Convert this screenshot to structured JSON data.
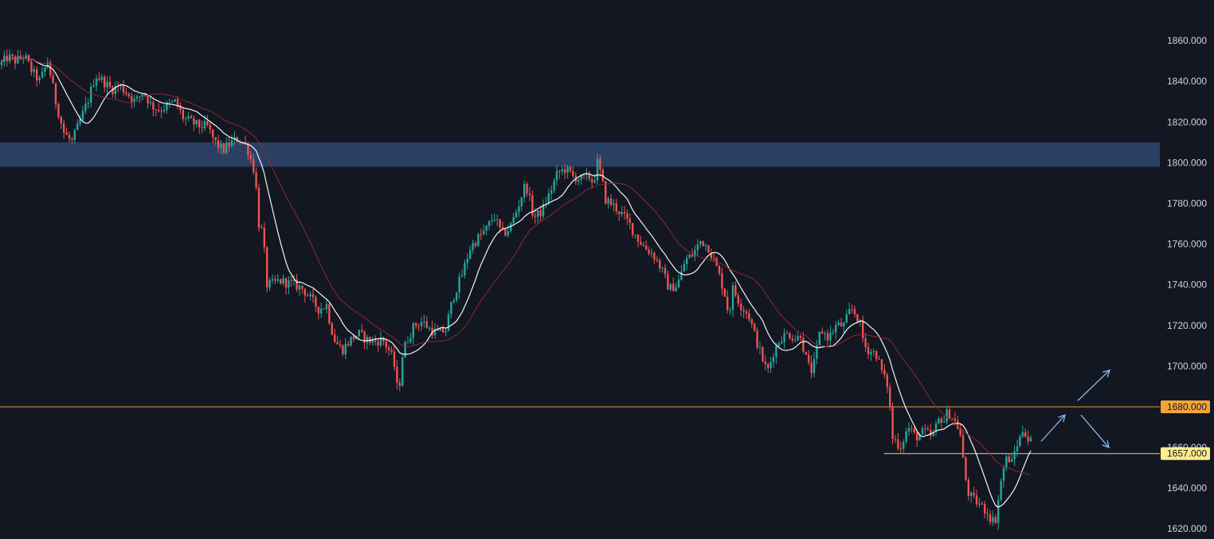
{
  "chart_data": {
    "type": "candlestick",
    "ylim": [
      1615,
      1880
    ],
    "y_ticks": [
      {
        "value": 1620,
        "label": "1620.000"
      },
      {
        "value": 1640,
        "label": "1640.000"
      },
      {
        "value": 1660,
        "label": "1660.000"
      },
      {
        "value": 1680,
        "label": "1680.000"
      },
      {
        "value": 1700,
        "label": "1700.000"
      },
      {
        "value": 1720,
        "label": "1720.000"
      },
      {
        "value": 1740,
        "label": "1740.000"
      },
      {
        "value": 1760,
        "label": "1760.000"
      },
      {
        "value": 1780,
        "label": "1780.000"
      },
      {
        "value": 1800,
        "label": "1800.000"
      },
      {
        "value": 1820,
        "label": "1820.000"
      },
      {
        "value": 1840,
        "label": "1840.000"
      },
      {
        "value": 1860,
        "label": "1860.000"
      }
    ],
    "grid": false,
    "price_path": [
      [
        0,
        1848
      ],
      [
        10,
        1852
      ],
      [
        20,
        1850
      ],
      [
        30,
        1853
      ],
      [
        40,
        1845
      ],
      [
        50,
        1840
      ],
      [
        60,
        1850
      ],
      [
        70,
        1830
      ],
      [
        80,
        1815
      ],
      [
        90,
        1810
      ],
      [
        100,
        1820
      ],
      [
        110,
        1830
      ],
      [
        120,
        1843
      ],
      [
        130,
        1840
      ],
      [
        140,
        1836
      ],
      [
        150,
        1838
      ],
      [
        160,
        1834
      ],
      [
        170,
        1830
      ],
      [
        180,
        1835
      ],
      [
        190,
        1828
      ],
      [
        200,
        1826
      ],
      [
        210,
        1828
      ],
      [
        220,
        1830
      ],
      [
        230,
        1822
      ],
      [
        240,
        1820
      ],
      [
        250,
        1818
      ],
      [
        260,
        1818
      ],
      [
        270,
        1810
      ],
      [
        280,
        1806
      ],
      [
        290,
        1810
      ],
      [
        300,
        1812
      ],
      [
        310,
        1808
      ],
      [
        320,
        1795
      ],
      [
        325,
        1770
      ],
      [
        330,
        1765
      ],
      [
        335,
        1740
      ],
      [
        340,
        1740
      ],
      [
        350,
        1742
      ],
      [
        360,
        1741
      ],
      [
        370,
        1740
      ],
      [
        380,
        1738
      ],
      [
        390,
        1733
      ],
      [
        400,
        1728
      ],
      [
        410,
        1730
      ],
      [
        415,
        1720
      ],
      [
        420,
        1713
      ],
      [
        425,
        1710
      ],
      [
        430,
        1708
      ],
      [
        440,
        1713
      ],
      [
        450,
        1716
      ],
      [
        460,
        1713
      ],
      [
        470,
        1712
      ],
      [
        480,
        1713
      ],
      [
        490,
        1707
      ],
      [
        495,
        1700
      ],
      [
        500,
        1685
      ],
      [
        505,
        1705
      ],
      [
        510,
        1712
      ],
      [
        520,
        1720
      ],
      [
        530,
        1722
      ],
      [
        540,
        1718
      ],
      [
        550,
        1716
      ],
      [
        560,
        1718
      ],
      [
        565,
        1728
      ],
      [
        570,
        1735
      ],
      [
        580,
        1745
      ],
      [
        590,
        1758
      ],
      [
        600,
        1763
      ],
      [
        610,
        1767
      ],
      [
        620,
        1774
      ],
      [
        630,
        1765
      ],
      [
        635,
        1766
      ],
      [
        640,
        1768
      ],
      [
        650,
        1778
      ],
      [
        660,
        1790
      ],
      [
        670,
        1773
      ],
      [
        680,
        1776
      ],
      [
        690,
        1785
      ],
      [
        700,
        1795
      ],
      [
        710,
        1797
      ],
      [
        720,
        1793
      ],
      [
        730,
        1792
      ],
      [
        740,
        1793
      ],
      [
        745,
        1790
      ],
      [
        750,
        1800
      ],
      [
        755,
        1793
      ],
      [
        760,
        1782
      ],
      [
        770,
        1779
      ],
      [
        780,
        1775
      ],
      [
        790,
        1770
      ],
      [
        800,
        1763
      ],
      [
        810,
        1758
      ],
      [
        820,
        1755
      ],
      [
        830,
        1748
      ],
      [
        840,
        1738
      ],
      [
        850,
        1740
      ],
      [
        855,
        1745
      ],
      [
        860,
        1752
      ],
      [
        870,
        1755
      ],
      [
        880,
        1762
      ],
      [
        890,
        1758
      ],
      [
        900,
        1748
      ],
      [
        905,
        1742
      ],
      [
        910,
        1735
      ],
      [
        915,
        1725
      ],
      [
        920,
        1738
      ],
      [
        930,
        1730
      ],
      [
        940,
        1725
      ],
      [
        950,
        1712
      ],
      [
        960,
        1700
      ],
      [
        965,
        1698
      ],
      [
        970,
        1706
      ],
      [
        980,
        1714
      ],
      [
        990,
        1716
      ],
      [
        1000,
        1713
      ],
      [
        1005,
        1716
      ],
      [
        1010,
        1706
      ],
      [
        1015,
        1700
      ],
      [
        1020,
        1697
      ],
      [
        1030,
        1718
      ],
      [
        1040,
        1714
      ],
      [
        1050,
        1720
      ],
      [
        1060,
        1720
      ],
      [
        1065,
        1726
      ],
      [
        1070,
        1728
      ],
      [
        1075,
        1725
      ],
      [
        1080,
        1720
      ],
      [
        1085,
        1710
      ],
      [
        1090,
        1708
      ],
      [
        1100,
        1706
      ],
      [
        1110,
        1694
      ],
      [
        1115,
        1690
      ],
      [
        1120,
        1665
      ],
      [
        1125,
        1663
      ],
      [
        1130,
        1660
      ],
      [
        1140,
        1670
      ],
      [
        1150,
        1665
      ],
      [
        1160,
        1668
      ],
      [
        1170,
        1665
      ],
      [
        1180,
        1675
      ],
      [
        1185,
        1673
      ],
      [
        1190,
        1678
      ],
      [
        1200,
        1672
      ],
      [
        1205,
        1668
      ],
      [
        1210,
        1650
      ],
      [
        1215,
        1638
      ],
      [
        1220,
        1635
      ],
      [
        1230,
        1632
      ],
      [
        1240,
        1628
      ],
      [
        1245,
        1624
      ],
      [
        1250,
        1625
      ],
      [
        1255,
        1640
      ],
      [
        1260,
        1650
      ],
      [
        1265,
        1656
      ],
      [
        1270,
        1652
      ],
      [
        1275,
        1660
      ],
      [
        1280,
        1664
      ],
      [
        1285,
        1670
      ],
      [
        1290,
        1664
      ],
      [
        1295,
        1663
      ]
    ],
    "moving_averages": [
      {
        "color": "#ffffff",
        "period": 12
      },
      {
        "color": "#8c2b35",
        "period": 28
      }
    ],
    "resistance_zone": {
      "low": 1798,
      "high": 1810,
      "color": "#2a3f63"
    },
    "horizontal_lines": [
      {
        "value": 1680,
        "label": "1680.000",
        "color": "#e89a2c",
        "tag_color": "#f2a53a"
      },
      {
        "value": 1657,
        "label": "1657.000",
        "color": "#e8d87a",
        "tag_color": "#ffec8a"
      }
    ],
    "projection_arrows": [
      {
        "from": [
          1307,
          1663
        ],
        "to": [
          1337,
          1676
        ]
      },
      {
        "from": [
          1353,
          1683
        ],
        "to": [
          1393,
          1698
        ]
      },
      {
        "from": [
          1357,
          1676
        ],
        "to": [
          1392,
          1660
        ]
      }
    ],
    "colors": {
      "background": "#131722",
      "up_candle": "#26a69a",
      "down_candle": "#ef5350",
      "arrow": "#8ab8ec",
      "axis_text": "#d1d4dc"
    }
  }
}
